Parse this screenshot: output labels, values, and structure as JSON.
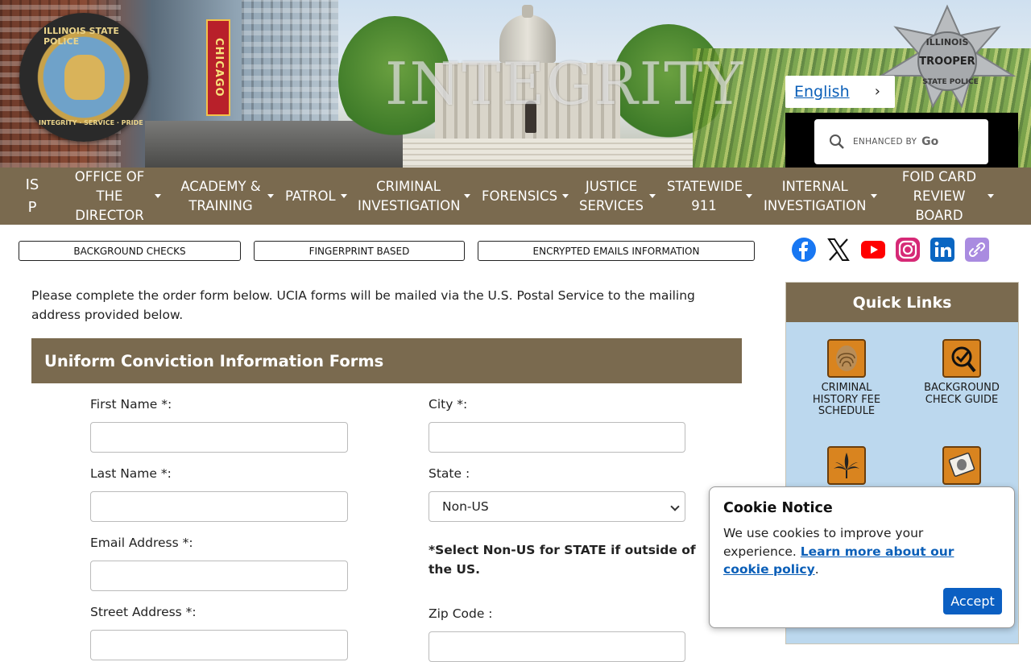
{
  "banner": {
    "watermark": "INTEGRITY",
    "seal_text": [
      "ILLINOIS STATE POLICE",
      "INTEGRITY · SERVICE · PRIDE"
    ],
    "city_sign": "CHICAGO",
    "badge_text": [
      "ILLINOIS",
      "TROOPER",
      "STATE POLICE"
    ],
    "language": "English",
    "search_enhanced": "ENHANCED BY",
    "search_brand": "Go"
  },
  "nav": {
    "items": [
      {
        "label": "IS P"
      },
      {
        "label": "OFFICE OF THE DIRECTOR"
      },
      {
        "label": "ACADEMY & TRAINING"
      },
      {
        "label": "PATROL"
      },
      {
        "label": "CRIMINAL INVESTIGATION"
      },
      {
        "label": "FORENSICS"
      },
      {
        "label": "JUSTICE SERVICES"
      },
      {
        "label": "STATEWIDE 911"
      },
      {
        "label": "INTERNAL INVESTIGATION"
      },
      {
        "label": "FOID CARD REVIEW BOARD"
      }
    ]
  },
  "quick_buttons": [
    "BACKGROUND CHECKS",
    "FINGERPRINT BASED",
    "ENCRYPTED EMAILS INFORMATION"
  ],
  "social": [
    "facebook-icon",
    "x-icon",
    "youtube-icon",
    "instagram-icon",
    "linkedin-icon",
    "link-icon"
  ],
  "main": {
    "intro": "Please complete the order form below. UCIA forms will be mailed via the U.S. Postal Service to the mailing address provided below.",
    "form_title": "Uniform Conviction Information Forms",
    "fields": {
      "first_name": "First Name *:",
      "last_name": "Last Name *:",
      "email": "Email Address *:",
      "street": "Street Address *:",
      "city": "City *:",
      "state": "State :",
      "state_value": "Non-US",
      "zip": "Zip Code :"
    },
    "state_note": "*Select Non-US for STATE if outside of the US."
  },
  "quick_links": {
    "title": "Quick Links",
    "items": [
      {
        "label": "CRIMINAL HISTORY FEE SCHEDULE",
        "icon": "fingerprint-icon"
      },
      {
        "label": "BACKGROUND CHECK GUIDE",
        "icon": "magnifier-check-icon"
      },
      {
        "label": "",
        "icon": "cannabis-icon"
      },
      {
        "label": "",
        "icon": "fingerprint-card-icon"
      }
    ]
  },
  "cookie": {
    "title": "Cookie Notice",
    "text": "We use cookies to improve your experience.",
    "link": "Learn more about our cookie policy",
    "accept": "Accept"
  },
  "colors": {
    "brown": "#7a6a4f",
    "link_blue": "#0b5fb8",
    "accept_blue": "#0b5fc2",
    "quicklinks_bg": "#bcd8ee"
  }
}
